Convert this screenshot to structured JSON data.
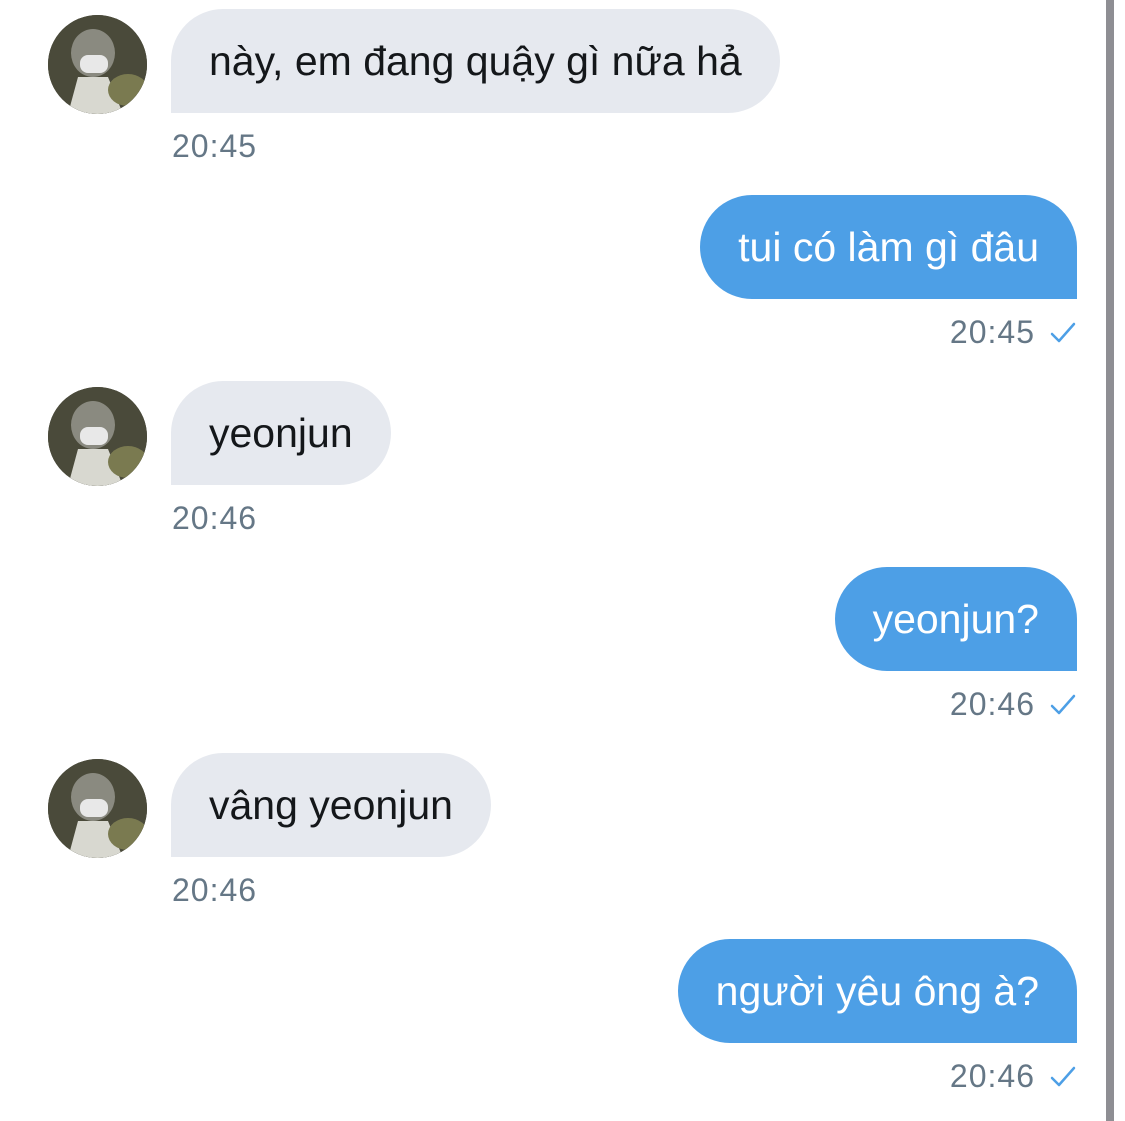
{
  "messages": [
    {
      "side": "in",
      "text": "này, em đang quậy gì nữa hả",
      "time": "20:45"
    },
    {
      "side": "out",
      "text": "tui có làm gì đâu",
      "time": "20:45"
    },
    {
      "side": "in",
      "text": "yeonjun",
      "time": "20:46"
    },
    {
      "side": "out",
      "text": "yeonjun?",
      "time": "20:46"
    },
    {
      "side": "in",
      "text": "vâng yeonjun",
      "time": "20:46"
    },
    {
      "side": "out",
      "text": "người yêu ông à?",
      "time": "20:46"
    }
  ],
  "colors": {
    "incoming_bubble": "#e6e9ef",
    "outgoing_bubble": "#4d9fe6",
    "timestamp": "#657786",
    "read_check": "#4d9fe6"
  },
  "icons": {
    "read_receipt": "check-icon",
    "contact_avatar": "avatar"
  }
}
